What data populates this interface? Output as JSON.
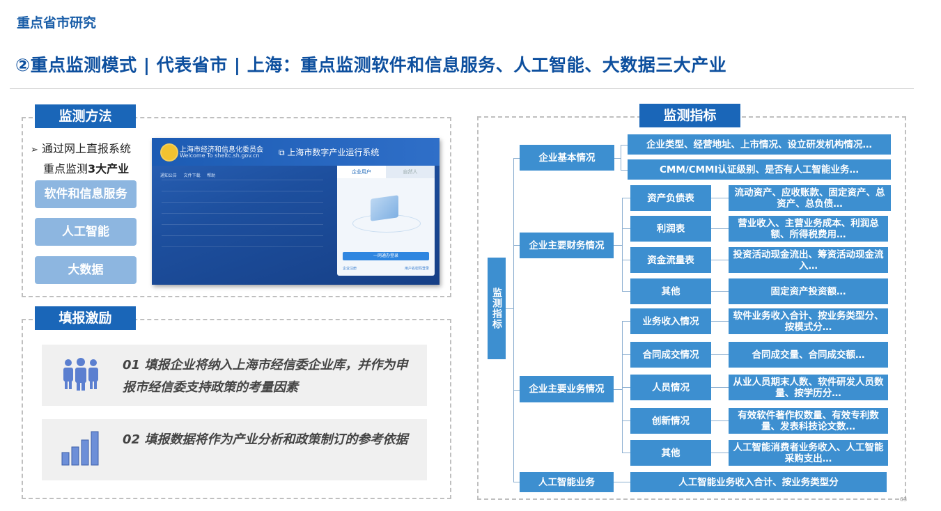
{
  "header": {
    "section": "重点省市研究",
    "title": "②重点监测模式 | 代表省市 | 上海：重点监测软件和信息服务、人工智能、大数据三大产业"
  },
  "method": {
    "tag": "监测方法",
    "line1": "通过网上直报系统",
    "line2_pre": "重点监测",
    "line2_bold": "3大产业",
    "industries": [
      "软件和信息服务",
      "人工智能",
      "大数据"
    ],
    "screenshot": {
      "org": "上海市经济和信息化委员会",
      "site": "Welcome To sheitc.sh.gov.cn",
      "system": "上海市数字产业运行系统",
      "nav": [
        "通知公告",
        "文件下载",
        "帮助"
      ],
      "tab_active": "企业用户",
      "tab_inactive": "自然人",
      "login_button": "一网通办登录",
      "link_left": "企业注册",
      "link_right": "用户名密码登录"
    }
  },
  "incentive": {
    "tag": "填报激励",
    "items": [
      {
        "icon": "people-icon",
        "text": "01  填报企业将纳入上海市经信委企业库，并作为申报市经信委支持政策的考量因素"
      },
      {
        "icon": "bar-chart-icon",
        "text": "02  填报数据将作为产业分析和政策制订的参考依据"
      }
    ]
  },
  "indicators": {
    "tag": "监测指标",
    "root": "监测指标",
    "basic": {
      "label": "企业基本情况",
      "details": [
        "企业类型、经营地址、上市情况、设立研发机构情况…",
        "CMM/CMMI认证级别、是否有人工智能业务…"
      ]
    },
    "finance": {
      "label": "企业主要财务情况",
      "items": [
        {
          "label": "资产负债表",
          "detail": "流动资产、应收账款、固定资产、总资产、总负债…"
        },
        {
          "label": "利润表",
          "detail": "营业收入、主营业务成本、利润总额、所得税费用…"
        },
        {
          "label": "资金流量表",
          "detail": "投资活动现金流出、筹资活动现金流入…"
        },
        {
          "label": "其他",
          "detail": "固定资产投资额…"
        }
      ]
    },
    "business": {
      "label": "企业主要业务情况",
      "items": [
        {
          "label": "业务收入情况",
          "detail": "软件业务收入合计、按业务类型分、按模式分…"
        },
        {
          "label": "合同成交情况",
          "detail": "合同成交量、合同成交额…"
        },
        {
          "label": "人员情况",
          "detail": "从业人员期末人数、软件研发人员数量、按学历分…"
        },
        {
          "label": "创新情况",
          "detail": "有效软件著作权数量、有效专利数量、发表科技论文数…"
        },
        {
          "label": "其他",
          "detail": "人工智能消费者业务收入、人工智能采购支出…"
        }
      ]
    },
    "ai": {
      "label": "人工智能业务",
      "detail": "人工智能业务收入合计、按业务类型分"
    }
  },
  "page_number": "63"
}
